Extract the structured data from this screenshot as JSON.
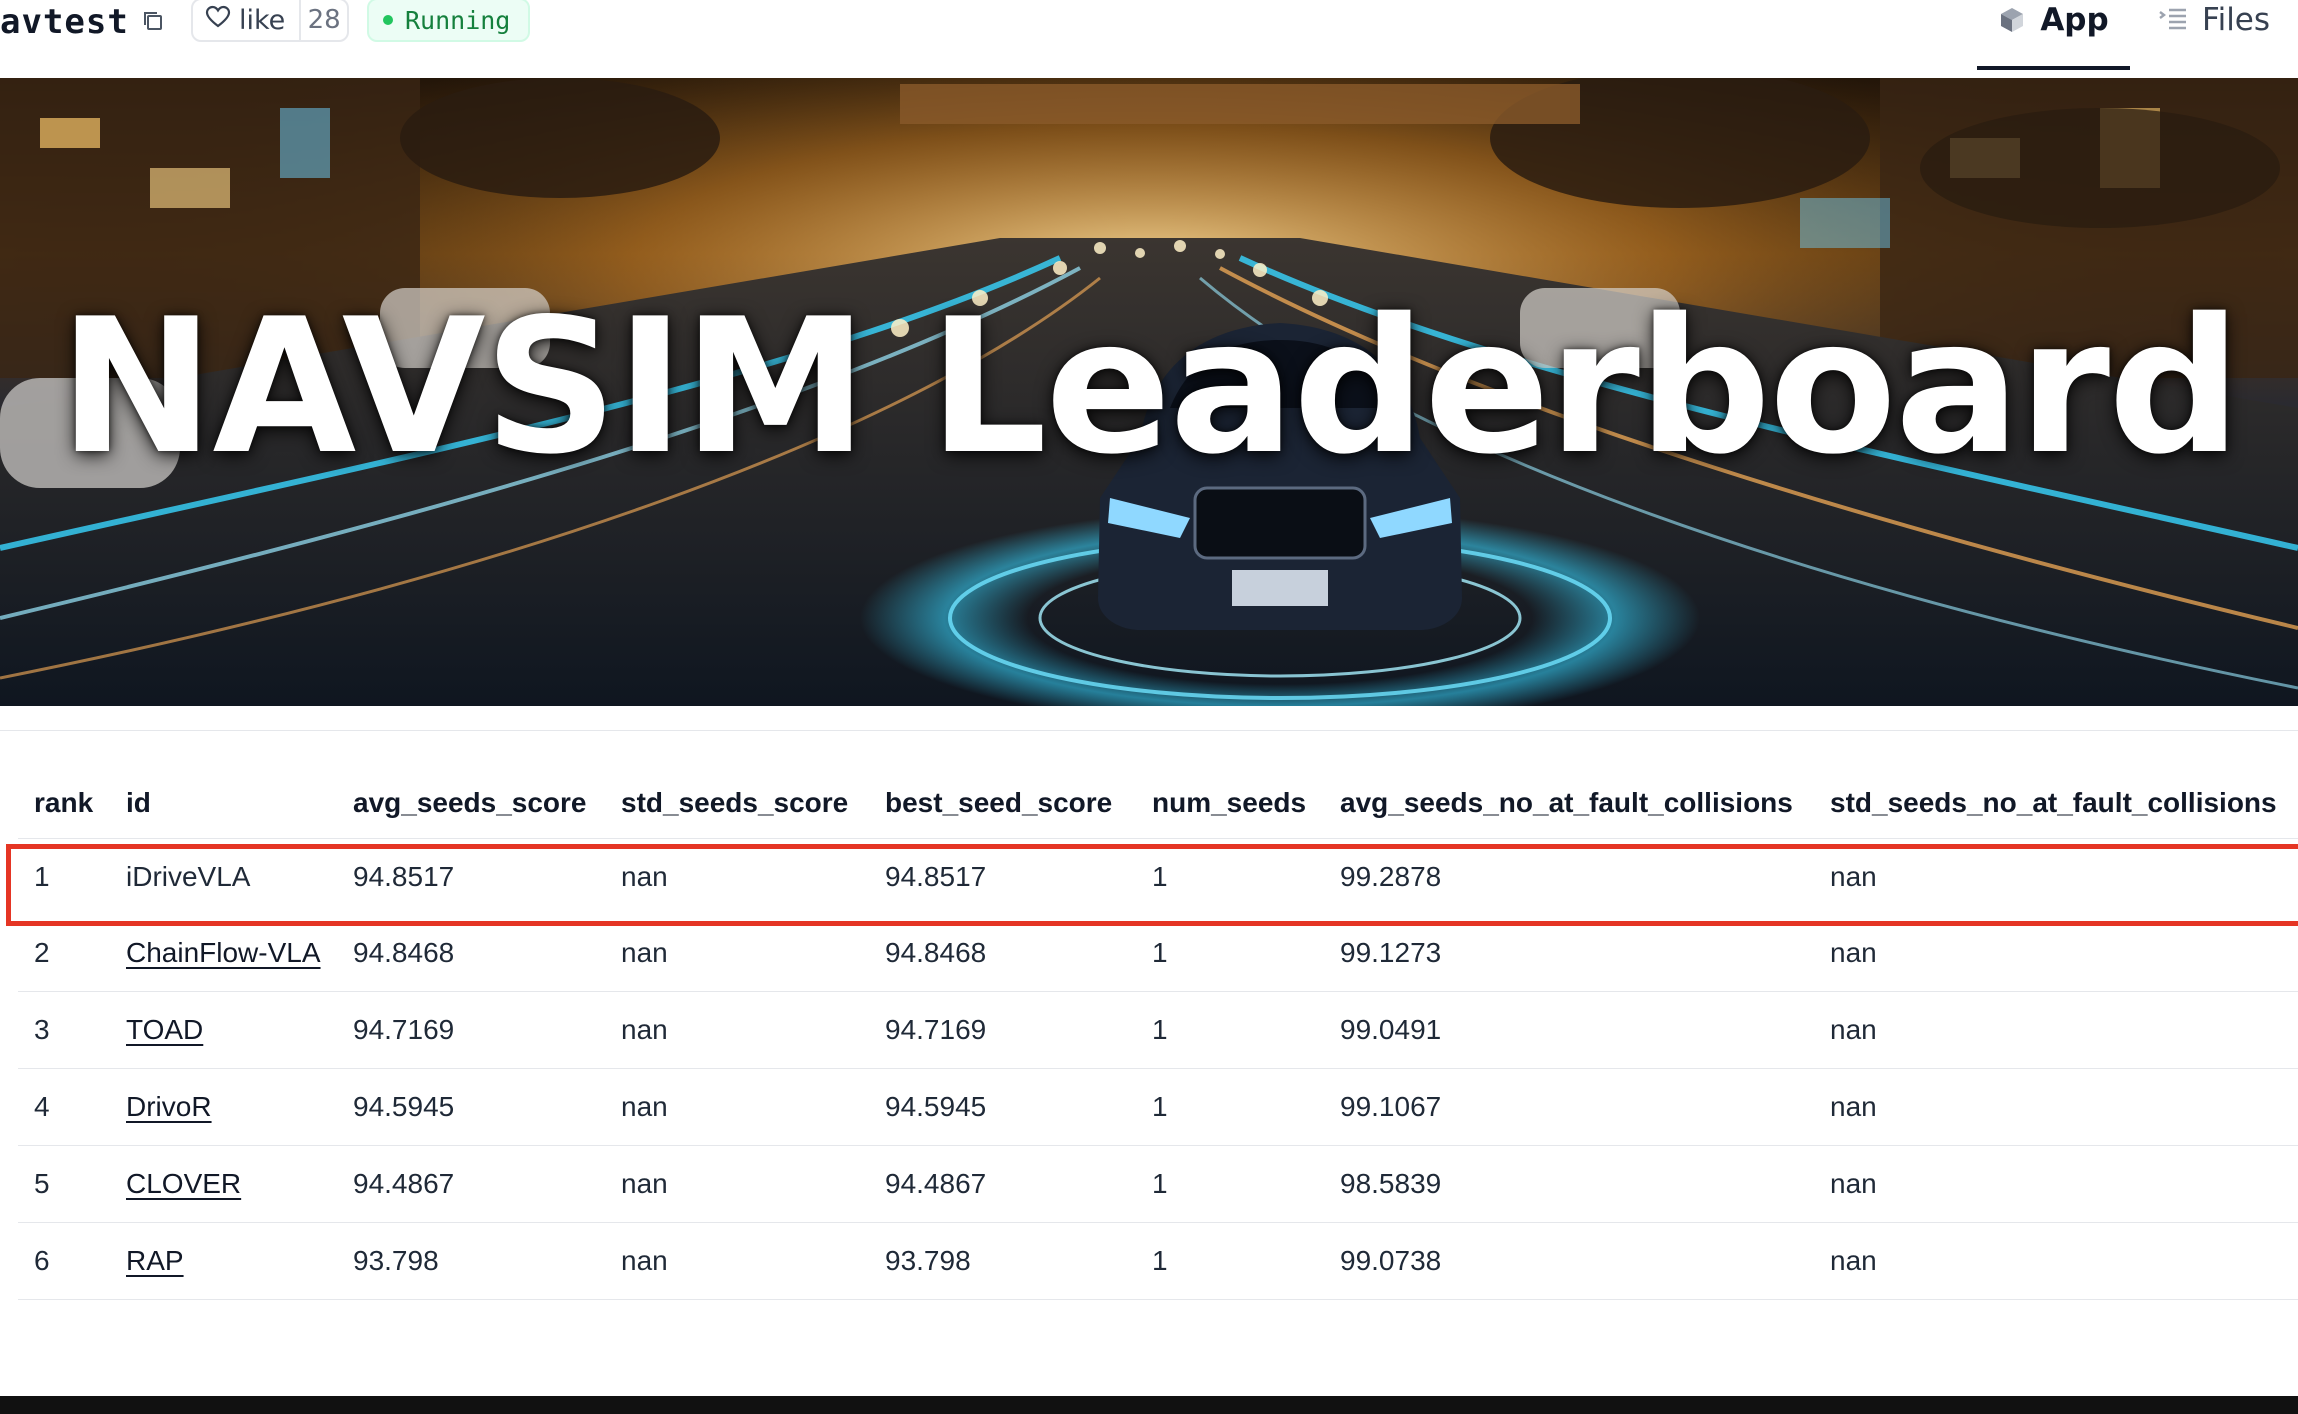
{
  "header": {
    "space_name": "avtest",
    "like_label": "like",
    "like_count": "28",
    "status": "Running",
    "tabs": [
      {
        "label": "App",
        "active": true
      },
      {
        "label": "Files",
        "active": false
      }
    ]
  },
  "banner": {
    "title": "NAVSIM Leaderboard"
  },
  "table": {
    "columns": [
      "rank",
      "id",
      "avg_seeds_score",
      "std_seeds_score",
      "best_seed_score",
      "num_seeds",
      "avg_seeds_no_at_fault_collisions",
      "std_seeds_no_at_fault_collisions"
    ],
    "rows": [
      {
        "rank": "1",
        "id": "iDriveVLA",
        "linked": false,
        "avg": "94.8517",
        "std": "nan",
        "best": "94.8517",
        "num": "1",
        "avg_nc": "99.2878",
        "std_nc": "nan"
      },
      {
        "rank": "2",
        "id": "ChainFlow-VLA",
        "linked": true,
        "avg": "94.8468",
        "std": "nan",
        "best": "94.8468",
        "num": "1",
        "avg_nc": "99.1273",
        "std_nc": "nan"
      },
      {
        "rank": "3",
        "id": "TOAD",
        "linked": true,
        "avg": "94.7169",
        "std": "nan",
        "best": "94.7169",
        "num": "1",
        "avg_nc": "99.0491",
        "std_nc": "nan"
      },
      {
        "rank": "4",
        "id": "DrivoR",
        "linked": true,
        "avg": "94.5945",
        "std": "nan",
        "best": "94.5945",
        "num": "1",
        "avg_nc": "99.1067",
        "std_nc": "nan"
      },
      {
        "rank": "5",
        "id": "CLOVER",
        "linked": true,
        "avg": "94.4867",
        "std": "nan",
        "best": "94.4867",
        "num": "1",
        "avg_nc": "98.5839",
        "std_nc": "nan"
      },
      {
        "rank": "6",
        "id": "RAP",
        "linked": true,
        "avg": "93.798",
        "std": "nan",
        "best": "93.798",
        "num": "1",
        "avg_nc": "99.0738",
        "std_nc": "nan"
      }
    ]
  },
  "colors": {
    "highlight_border": "#e53524",
    "status_green": "#15803d",
    "accent_cyan": "#38d6ff"
  }
}
